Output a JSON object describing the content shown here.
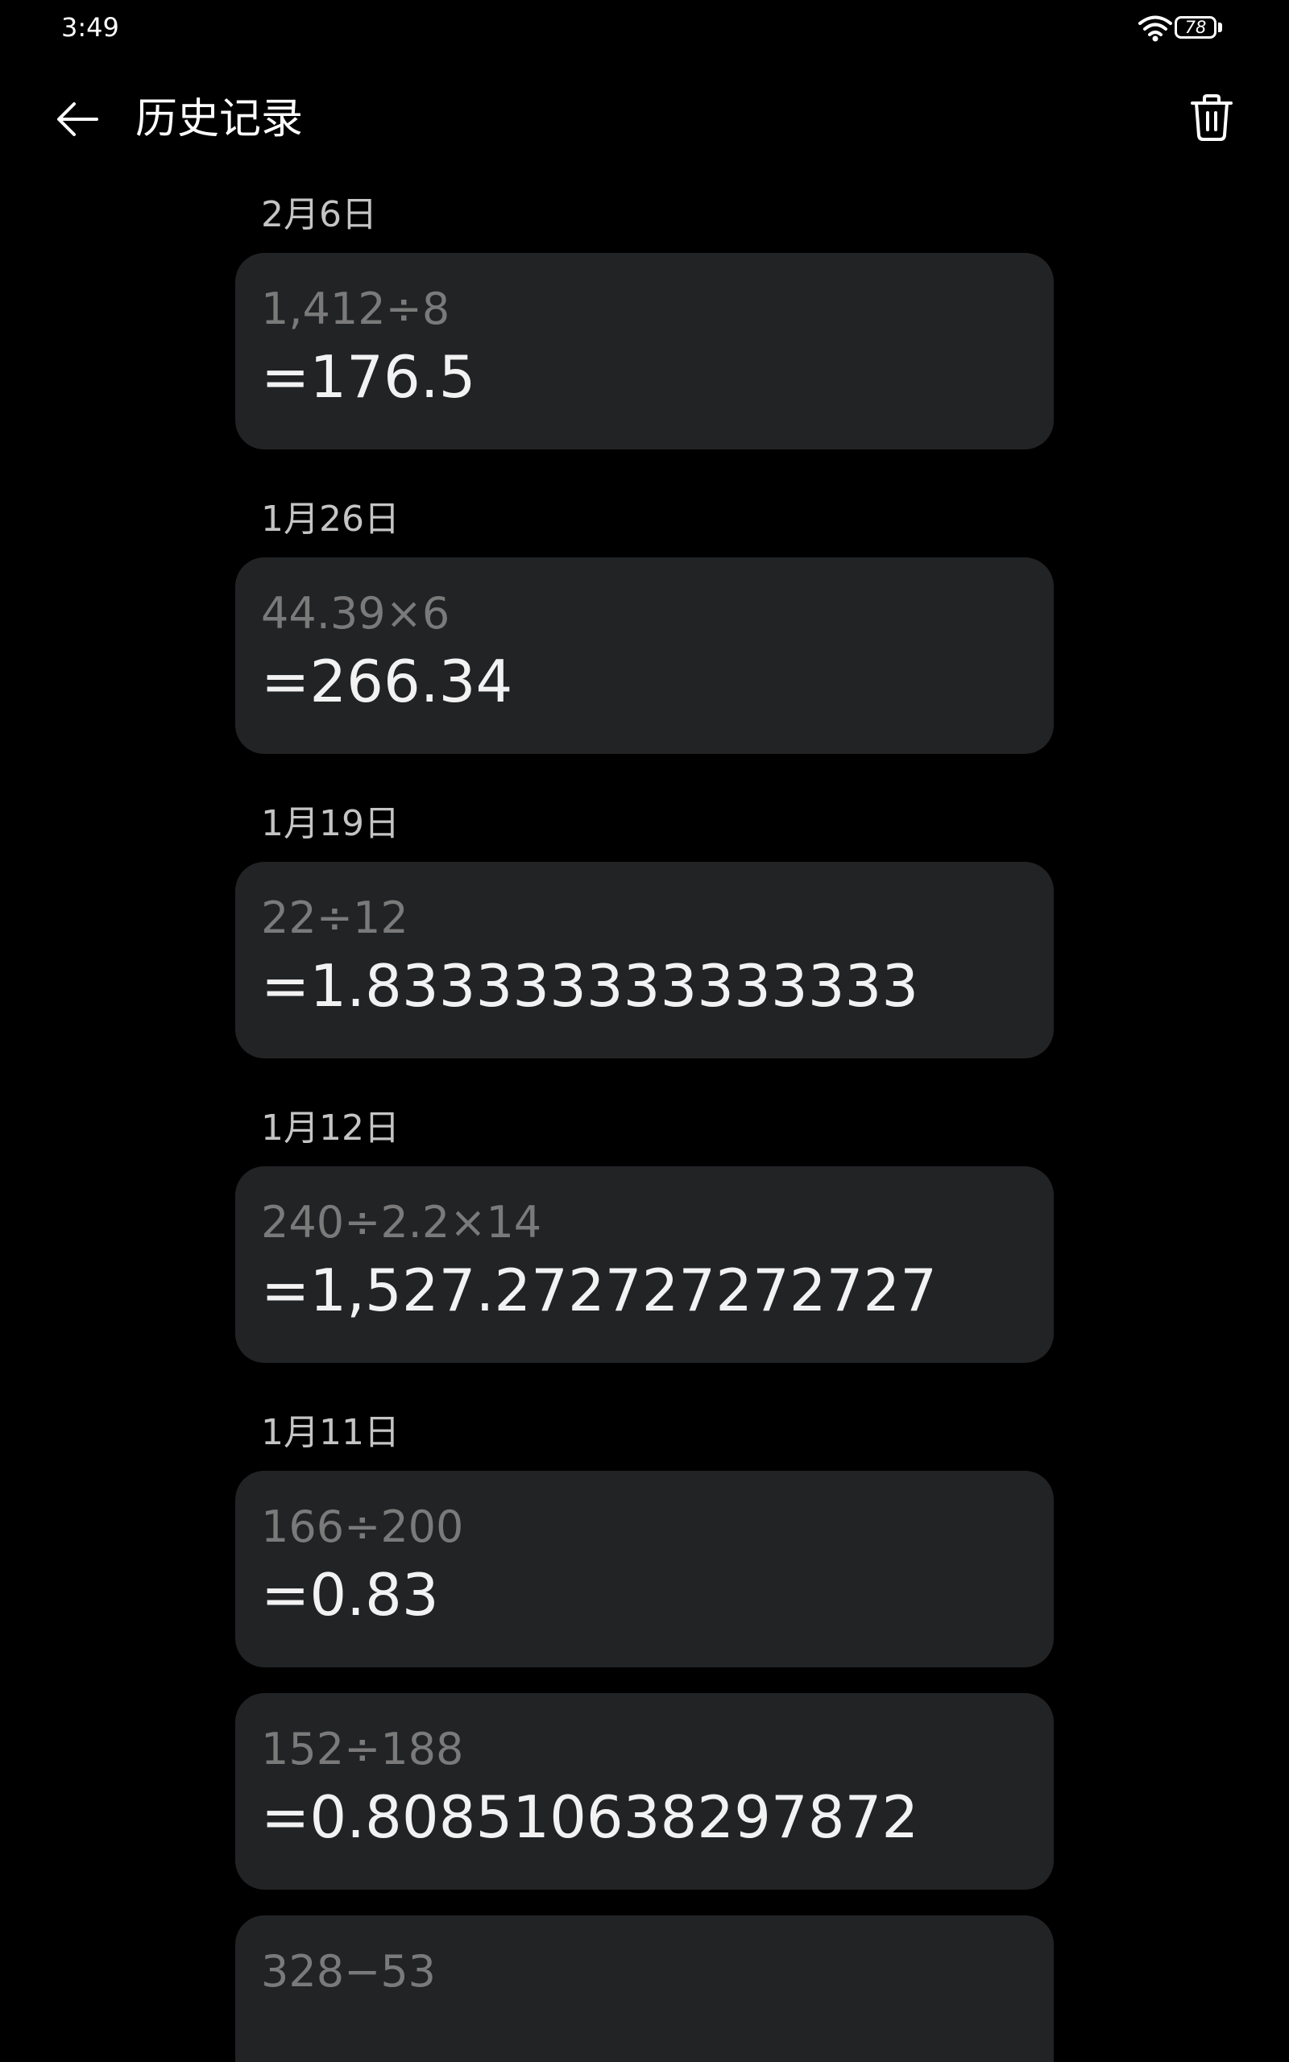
{
  "status_bar": {
    "time": "3:49",
    "battery_level": "78",
    "icons": [
      "wifi-icon",
      "battery-icon"
    ]
  },
  "header": {
    "title": "历史记录",
    "back_icon": "arrow-left-icon",
    "delete_icon": "trash-icon"
  },
  "colors": {
    "background": "#000000",
    "card": "#222325",
    "expression_text": "#7a7a7a",
    "result_text": "#f2f2f2",
    "date_text": "#c4c4c4"
  },
  "history": [
    {
      "date": "2月6日",
      "expression": "1,412÷8",
      "result": "=176.5"
    },
    {
      "date": "1月26日",
      "expression": "44.39×6",
      "result": "=266.34"
    },
    {
      "date": "1月19日",
      "expression": "22÷12",
      "result": "=1.833333333333333"
    },
    {
      "date": "1月12日",
      "expression": "240÷2.2×14",
      "result": "=1,527.272727272727"
    },
    {
      "date": "1月11日",
      "expression": "166÷200",
      "result": "=0.83"
    },
    {
      "date": "",
      "expression": "152÷188",
      "result": "=0.808510638297872"
    },
    {
      "date": "",
      "expression": "328−53",
      "result": ""
    }
  ]
}
